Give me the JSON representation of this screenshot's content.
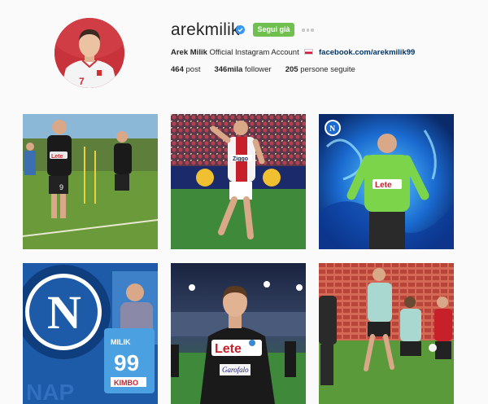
{
  "profile": {
    "username": "arekmilik",
    "follow_label": "Segui già",
    "full_name": "Arek Milik",
    "bio_text": "Official Instagram Account",
    "link": "facebook.com/arekmilik99",
    "stats": {
      "posts_count": "464",
      "posts_label": "post",
      "followers_count": "346mila",
      "followers_label": "follower",
      "following_count": "205",
      "following_label": "persone seguite"
    }
  },
  "icons": {
    "verified": "verified-badge-icon",
    "more": "more-options-icon",
    "flag": "poland-flag-icon"
  },
  "colors": {
    "follow_button": "#70c050",
    "verified": "#3897f0",
    "link": "#003569",
    "background": "#fafafa"
  },
  "posts": [
    {
      "caption": "Lete",
      "jersey_number": "9"
    },
    {
      "caption": "Ziggo"
    },
    {
      "caption": "Lete"
    },
    {
      "caption": "MILIK",
      "jersey_number": "99",
      "sponsor": "KIMBO"
    },
    {
      "caption": "Lete",
      "sponsor": "Garofalo"
    },
    {
      "caption": ""
    }
  ]
}
